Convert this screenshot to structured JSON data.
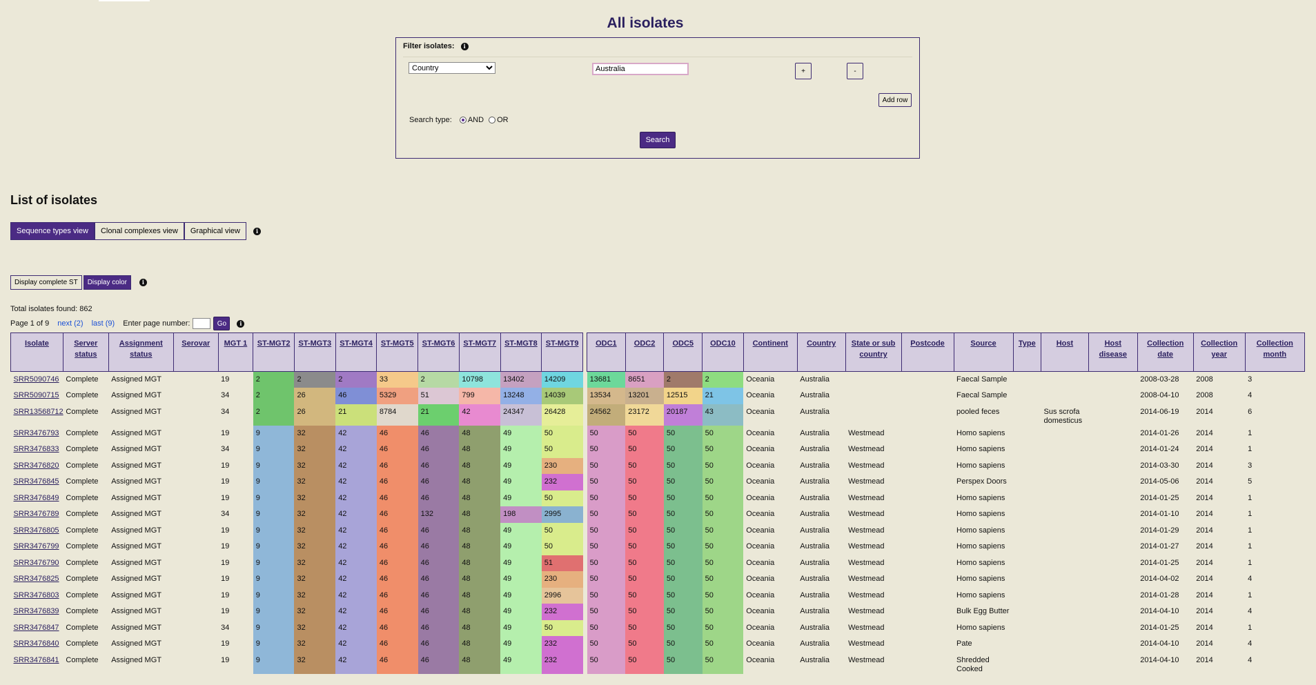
{
  "page_title": "All isolates",
  "filter": {
    "label": "Filter isolates:",
    "field_selected": "Country",
    "value": "Australia",
    "plus_label": "+",
    "minus_label": "-",
    "add_row_label": "Add row",
    "search_type_label": "Search type:",
    "and_label": "AND",
    "or_label": "OR",
    "search_label": "Search"
  },
  "list_title": "List of isolates",
  "view_tabs": [
    "Sequence types view",
    "Clonal complexes view",
    "Graphical view"
  ],
  "display_buttons": [
    "Display complete ST",
    "Display color"
  ],
  "total_found": "Total isolates found: 862",
  "pager": {
    "page_info": "Page 1 of 9",
    "next_label": "next (2)",
    "last_label": "last (9)",
    "enter_label": "Enter page number:",
    "go_label": "Go"
  },
  "columns": [
    "Isolate",
    "Server status",
    "Assignment status",
    "Serovar",
    "MGT 1",
    "ST-MGT2",
    "ST-MGT3",
    "ST-MGT4",
    "ST-MGT5",
    "ST-MGT6",
    "ST-MGT7",
    "ST-MGT8",
    "ST-MGT9",
    "",
    "ODC1",
    "ODC2",
    "ODC5",
    "ODC10",
    "Continent",
    "Country",
    "State or sub country",
    "Postcode",
    "Source",
    "Type",
    "Host",
    "Host disease",
    "Collection date",
    "Collection year",
    "Collection month"
  ],
  "rows": [
    [
      "SRR5090746",
      "Complete",
      "Assigned MGT",
      "",
      "19",
      "2",
      "2",
      "2",
      "33",
      "2",
      "10798",
      "13402",
      "14209",
      "",
      "13681",
      "8651",
      "2",
      "2",
      "Oceania",
      "Australia",
      "",
      "",
      "Faecal Sample",
      "",
      "",
      "",
      "2008-03-28",
      "2008",
      "3"
    ],
    [
      "SRR5090715",
      "Complete",
      "Assigned MGT",
      "",
      "34",
      "2",
      "26",
      "46",
      "5329",
      "51",
      "799",
      "13248",
      "14039",
      "",
      "13534",
      "13201",
      "12515",
      "21",
      "Oceania",
      "Australia",
      "",
      "",
      "Faecal Sample",
      "",
      "",
      "",
      "2008-04-10",
      "2008",
      "4"
    ],
    [
      "SRR13568712",
      "Complete",
      "Assigned MGT",
      "",
      "34",
      "2",
      "26",
      "21",
      "8784",
      "21",
      "42",
      "24347",
      "26428",
      "",
      "24562",
      "23172",
      "20187",
      "43",
      "Oceania",
      "Australia",
      "",
      "",
      "pooled feces",
      "",
      "Sus scrofa domesticus",
      "",
      "2014-06-19",
      "2014",
      "6"
    ],
    [
      "SRR3476793",
      "Complete",
      "Assigned MGT",
      "",
      "19",
      "9",
      "32",
      "42",
      "46",
      "46",
      "48",
      "49",
      "50",
      "",
      "50",
      "50",
      "50",
      "50",
      "Oceania",
      "Australia",
      "Westmead",
      "",
      "Homo sapiens",
      "",
      "",
      "",
      "2014-01-26",
      "2014",
      "1"
    ],
    [
      "SRR3476833",
      "Complete",
      "Assigned MGT",
      "",
      "34",
      "9",
      "32",
      "42",
      "46",
      "46",
      "48",
      "49",
      "50",
      "",
      "50",
      "50",
      "50",
      "50",
      "Oceania",
      "Australia",
      "Westmead",
      "",
      "Homo sapiens",
      "",
      "",
      "",
      "2014-01-24",
      "2014",
      "1"
    ],
    [
      "SRR3476820",
      "Complete",
      "Assigned MGT",
      "",
      "19",
      "9",
      "32",
      "42",
      "46",
      "46",
      "48",
      "49",
      "230",
      "",
      "50",
      "50",
      "50",
      "50",
      "Oceania",
      "Australia",
      "Westmead",
      "",
      "Homo sapiens",
      "",
      "",
      "",
      "2014-03-30",
      "2014",
      "3"
    ],
    [
      "SRR3476845",
      "Complete",
      "Assigned MGT",
      "",
      "19",
      "9",
      "32",
      "42",
      "46",
      "46",
      "48",
      "49",
      "232",
      "",
      "50",
      "50",
      "50",
      "50",
      "Oceania",
      "Australia",
      "Westmead",
      "",
      "Perspex Doors",
      "",
      "",
      "",
      "2014-05-06",
      "2014",
      "5"
    ],
    [
      "SRR3476849",
      "Complete",
      "Assigned MGT",
      "",
      "19",
      "9",
      "32",
      "42",
      "46",
      "46",
      "48",
      "49",
      "50",
      "",
      "50",
      "50",
      "50",
      "50",
      "Oceania",
      "Australia",
      "Westmead",
      "",
      "Homo sapiens",
      "",
      "",
      "",
      "2014-01-25",
      "2014",
      "1"
    ],
    [
      "SRR3476789",
      "Complete",
      "Assigned MGT",
      "",
      "34",
      "9",
      "32",
      "42",
      "46",
      "132",
      "48",
      "198",
      "2995",
      "",
      "50",
      "50",
      "50",
      "50",
      "Oceania",
      "Australia",
      "Westmead",
      "",
      "Homo sapiens",
      "",
      "",
      "",
      "2014-01-10",
      "2014",
      "1"
    ],
    [
      "SRR3476805",
      "Complete",
      "Assigned MGT",
      "",
      "19",
      "9",
      "32",
      "42",
      "46",
      "46",
      "48",
      "49",
      "50",
      "",
      "50",
      "50",
      "50",
      "50",
      "Oceania",
      "Australia",
      "Westmead",
      "",
      "Homo sapiens",
      "",
      "",
      "",
      "2014-01-29",
      "2014",
      "1"
    ],
    [
      "SRR3476799",
      "Complete",
      "Assigned MGT",
      "",
      "19",
      "9",
      "32",
      "42",
      "46",
      "46",
      "48",
      "49",
      "50",
      "",
      "50",
      "50",
      "50",
      "50",
      "Oceania",
      "Australia",
      "Westmead",
      "",
      "Homo sapiens",
      "",
      "",
      "",
      "2014-01-27",
      "2014",
      "1"
    ],
    [
      "SRR3476790",
      "Complete",
      "Assigned MGT",
      "",
      "19",
      "9",
      "32",
      "42",
      "46",
      "46",
      "48",
      "49",
      "51",
      "",
      "50",
      "50",
      "50",
      "50",
      "Oceania",
      "Australia",
      "Westmead",
      "",
      "Homo sapiens",
      "",
      "",
      "",
      "2014-01-25",
      "2014",
      "1"
    ],
    [
      "SRR3476825",
      "Complete",
      "Assigned MGT",
      "",
      "19",
      "9",
      "32",
      "42",
      "46",
      "46",
      "48",
      "49",
      "230",
      "",
      "50",
      "50",
      "50",
      "50",
      "Oceania",
      "Australia",
      "Westmead",
      "",
      "Homo sapiens",
      "",
      "",
      "",
      "2014-04-02",
      "2014",
      "4"
    ],
    [
      "SRR3476803",
      "Complete",
      "Assigned MGT",
      "",
      "19",
      "9",
      "32",
      "42",
      "46",
      "46",
      "48",
      "49",
      "2996",
      "",
      "50",
      "50",
      "50",
      "50",
      "Oceania",
      "Australia",
      "Westmead",
      "",
      "Homo sapiens",
      "",
      "",
      "",
      "2014-01-28",
      "2014",
      "1"
    ],
    [
      "SRR3476839",
      "Complete",
      "Assigned MGT",
      "",
      "19",
      "9",
      "32",
      "42",
      "46",
      "46",
      "48",
      "49",
      "232",
      "",
      "50",
      "50",
      "50",
      "50",
      "Oceania",
      "Australia",
      "Westmead",
      "",
      "Bulk Egg Butter",
      "",
      "",
      "",
      "2014-04-10",
      "2014",
      "4"
    ],
    [
      "SRR3476847",
      "Complete",
      "Assigned MGT",
      "",
      "34",
      "9",
      "32",
      "42",
      "46",
      "46",
      "48",
      "49",
      "50",
      "",
      "50",
      "50",
      "50",
      "50",
      "Oceania",
      "Australia",
      "Westmead",
      "",
      "Homo sapiens",
      "",
      "",
      "",
      "2014-01-25",
      "2014",
      "1"
    ],
    [
      "SRR3476840",
      "Complete",
      "Assigned MGT",
      "",
      "19",
      "9",
      "32",
      "42",
      "46",
      "46",
      "48",
      "49",
      "232",
      "",
      "50",
      "50",
      "50",
      "50",
      "Oceania",
      "Australia",
      "Westmead",
      "",
      "Pate",
      "",
      "",
      "",
      "2014-04-10",
      "2014",
      "4"
    ],
    [
      "SRR3476841",
      "Complete",
      "Assigned MGT",
      "",
      "19",
      "9",
      "32",
      "42",
      "46",
      "46",
      "48",
      "49",
      "232",
      "",
      "50",
      "50",
      "50",
      "50",
      "Oceania",
      "Australia",
      "Westmead",
      "",
      "Shredded Cooked",
      "",
      "",
      "",
      "2014-04-10",
      "2014",
      "4"
    ]
  ],
  "cell_colors": {
    "5": {
      "2": "#6fc46c",
      "9": "#8fb7d8"
    },
    "6": {
      "2": "#8b8b8b",
      "26": "#d2b77e",
      "32": "#b98f62"
    },
    "7": {
      "2": "#a07ac4",
      "46": "#7f8fd6",
      "21": "#cbe07a",
      "42": "#a8a4d8"
    },
    "8": {
      "33": "#f5c98a",
      "5329": "#f0a080",
      "8784": "#e0d8cc",
      "46": "#f08e6a"
    },
    "9": {
      "2": "#b6d9a4",
      "51": "#dcc7d4",
      "21": "#6ccf6e",
      "46": "#9a7aa4",
      "132": "#9a7aa4"
    },
    "10": {
      "10798": "#8ee4dc",
      "799": "#f5b7a8",
      "42": "#e88ad0",
      "48": "#8f9f6e"
    },
    "11": {
      "13402": "#c5a1c0",
      "13248": "#93b0e6",
      "24347": "#c8c0d6",
      "49": "#b5efad",
      "198": "#c18fc3"
    },
    "12": {
      "14209": "#6fd6e0",
      "14039": "#a8c978",
      "26428": "#e6ee98",
      "50": "#d9ec8c",
      "230": "#e6b07f",
      "232": "#d070d0",
      "2995": "#8ab2d0",
      "2996": "#e6c49a",
      "51": "#e07070"
    },
    "14": {
      "13681": "#6cd89a",
      "13534": "#d4b88c",
      "24562": "#c2ad7a",
      "50": "#d99cc8"
    },
    "15": {
      "8651": "#d9a0c2",
      "13201": "#c9b08e",
      "23172": "#f0d898",
      "50": "#f07a8a"
    },
    "16": {
      "2": "#a07a6a",
      "12515": "#f2d48a",
      "20187": "#c07fd8",
      "50": "#7cbf8e"
    },
    "17": {
      "2": "#8edc80",
      "21": "#7ec4e6",
      "43": "#8cbcc4",
      "50": "#9ed688"
    }
  }
}
